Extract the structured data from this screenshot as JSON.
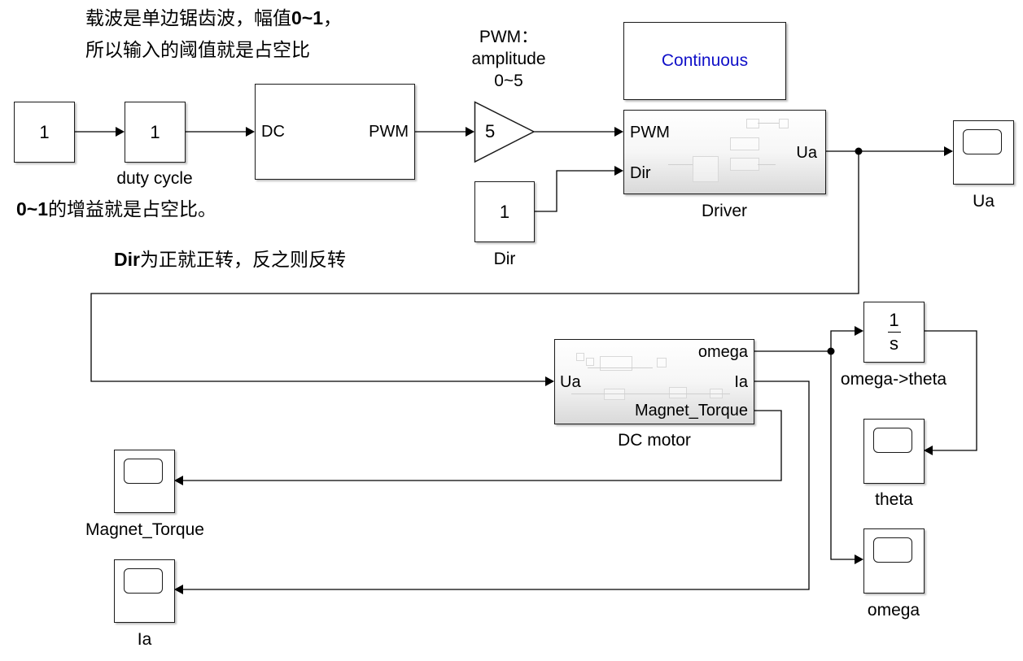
{
  "annotations": {
    "carrier_line1_prefix": "载波是单边锯齿波，幅值",
    "carrier_line1_bold": "0~1",
    "carrier_line1_suffix": "，",
    "carrier_line2": "所以输入的阈值就是占空比",
    "gain_note_bold": "0~1",
    "gain_note_rest": "的增益就是占空比。",
    "dir_note_bold": "Dir",
    "dir_note_rest": "为正就正转，反之则反转",
    "pwm_line1": "PWM：",
    "pwm_line2": "amplitude",
    "pwm_line3": "0~5"
  },
  "blocks": {
    "constant": {
      "value": "1"
    },
    "duty_cycle_gain": {
      "value": "1",
      "label": "duty cycle"
    },
    "pwm_generator": {
      "in_port": "DC",
      "out_port": "PWM"
    },
    "amplitude_gain": {
      "value": "5"
    },
    "dir_constant": {
      "value": "1",
      "label": "Dir"
    },
    "continuous": {
      "label": "Continuous",
      "color": "#1010c8"
    },
    "driver": {
      "label": "Driver",
      "in_ports": [
        "PWM",
        "Dir"
      ],
      "out_port": "Ua"
    },
    "ua_scope": {
      "label": "Ua"
    },
    "dc_motor": {
      "label": "DC motor",
      "in_port": "Ua",
      "out_ports": [
        "omega",
        "Ia",
        "Magnet_Torque"
      ]
    },
    "integrator": {
      "numerator": "1",
      "denominator": "s",
      "label": "omega->theta"
    },
    "theta_scope": {
      "label": "theta"
    },
    "omega_scope": {
      "label": "omega"
    },
    "magnet_torque_scope": {
      "label": "Magnet_Torque"
    },
    "ia_scope": {
      "label": "Ia"
    }
  }
}
